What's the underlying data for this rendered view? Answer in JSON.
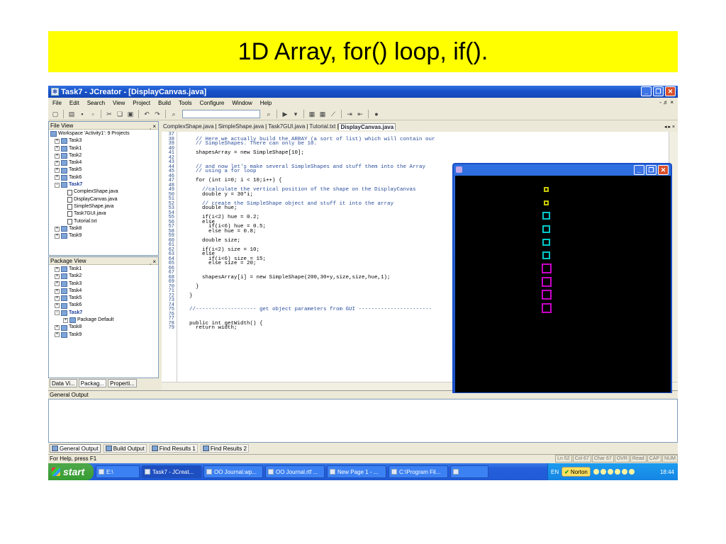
{
  "slide": {
    "title": "1D Array, for() loop, if()."
  },
  "window": {
    "title": "Task7 - JCreator - [DisplayCanvas.java]",
    "minimize": "_",
    "restore": "❐",
    "close": "✕",
    "mdi_controls": "- ♬ ×"
  },
  "menu": [
    "File",
    "Edit",
    "Search",
    "View",
    "Project",
    "Build",
    "Tools",
    "Configure",
    "Window",
    "Help"
  ],
  "file_view": {
    "title": "File View",
    "pin": "ฺ ×",
    "workspace": "Workspace 'Activity1': 9 Projects",
    "items": [
      {
        "label": "Task3",
        "depth": 0,
        "type": "project",
        "bold": false
      },
      {
        "label": "Task1",
        "depth": 0,
        "type": "project",
        "bold": false
      },
      {
        "label": "Task2",
        "depth": 0,
        "type": "project",
        "bold": false
      },
      {
        "label": "Task4",
        "depth": 0,
        "type": "project",
        "bold": false
      },
      {
        "label": "Task5",
        "depth": 0,
        "type": "project",
        "bold": false
      },
      {
        "label": "Task6",
        "depth": 0,
        "type": "project",
        "bold": false
      },
      {
        "label": "Task7",
        "depth": 0,
        "type": "project",
        "bold": true
      },
      {
        "label": "ComplexShape.java",
        "depth": 1,
        "type": "file",
        "bold": false
      },
      {
        "label": "DisplayCanvas.java",
        "depth": 1,
        "type": "file",
        "bold": false
      },
      {
        "label": "SimpleShape.java",
        "depth": 1,
        "type": "file",
        "bold": false
      },
      {
        "label": "Task7GUI.java",
        "depth": 1,
        "type": "file",
        "bold": false
      },
      {
        "label": "Tutorial.txt",
        "depth": 1,
        "type": "file",
        "bold": false
      },
      {
        "label": "Task8",
        "depth": 0,
        "type": "project",
        "bold": false
      },
      {
        "label": "Task9",
        "depth": 0,
        "type": "project",
        "bold": false
      }
    ]
  },
  "package_view": {
    "title": "Package View",
    "pin": "ฺ ×",
    "items": [
      {
        "label": "Task1",
        "depth": 0,
        "bold": false
      },
      {
        "label": "Task2",
        "depth": 0,
        "bold": false
      },
      {
        "label": "Task3",
        "depth": 0,
        "bold": false
      },
      {
        "label": "Task4",
        "depth": 0,
        "bold": false
      },
      {
        "label": "Task5",
        "depth": 0,
        "bold": false
      },
      {
        "label": "Task6",
        "depth": 0,
        "bold": false
      },
      {
        "label": "Task7",
        "depth": 0,
        "bold": true
      },
      {
        "label": "Package Default",
        "depth": 1,
        "bold": false
      },
      {
        "label": "Task8",
        "depth": 0,
        "bold": false
      },
      {
        "label": "Task9",
        "depth": 0,
        "bold": false
      }
    ]
  },
  "side_tabs": [
    "Data Vi...",
    "Packag...",
    "Properti..."
  ],
  "doc_tabs": [
    "ComplexShape.java",
    "SimpleShape.java",
    "Task7GUI.java",
    "Tutorial.txt",
    "DisplayCanvas.java"
  ],
  "doc_tab_arrows": "◂ ▸ ×",
  "line_numbers": [
    "37",
    "38",
    "39",
    "40",
    "41",
    "42",
    "43",
    "44",
    "45",
    "46",
    "47",
    "48",
    "49",
    "50",
    "51",
    "52",
    "53",
    "54",
    "55",
    "56",
    "57",
    "58",
    "59",
    "60",
    "61",
    "62",
    "63",
    "64",
    "65",
    "66",
    "67",
    "68",
    "69",
    "70",
    "71",
    "72",
    "73",
    "74",
    "75",
    "76",
    "77",
    "78",
    "79"
  ],
  "code_lines": [
    "",
    "    // Here we actually build the ARRAY (a sort of list) which will contain our",
    "    // SimpleShapes. There can only be 10.",
    "",
    "    shapesArray = new SimpleShape[10];",
    "",
    "",
    "    // and now let's make several SimpleShapes and stuff them into the Array",
    "    // using a for loop",
    "",
    "    for (int i=0; i < 10;i++) {",
    "",
    "      //calculate the vertical position of the shape on the DisplayCanvas",
    "      double y = 30*i;",
    "",
    "      // create the SimpleShape object and stuff it into the array",
    "      double hue;",
    "",
    "      if(i<2) hue = 0.2;",
    "      else",
    "        if(i<6) hue = 0.5;",
    "        else hue = 0.8;",
    "",
    "      double size;",
    "",
    "      if(i<2) size = 10;",
    "      else",
    "        if(i<6) size = 15;",
    "        else size = 20;",
    "",
    "",
    "      shapesArray[i] = new SimpleShape(200,30+y,size,size,hue,1);",
    "",
    "    }",
    "",
    "  }",
    "",
    "",
    "  //------------------- get object parameters from GUI -----------------------",
    "",
    "",
    "  public int getWidth() {",
    "    return width;"
  ],
  "output": {
    "title": "General Output"
  },
  "output_tabs": [
    "General Output",
    "Build Output",
    "Find Results 1",
    "Find Results 2"
  ],
  "status": {
    "text": "For Help, press F1",
    "cells": [
      "Ln 52",
      "Col 67",
      "Char 67",
      "OVR",
      "Read",
      "CAP",
      "NUM"
    ]
  },
  "taskbar": {
    "start": "start",
    "tasks": [
      "E:\\",
      "Task7 - JCreat...",
      "OO Journal.wp...",
      "OO Journal.rtf ...",
      "New Page 1 - ...",
      "C:\\Program Fil..."
    ],
    "lang": "EN",
    "norton": "Norton",
    "clock": "18:44"
  },
  "applet": {
    "shapes": [
      {
        "size": 10,
        "hue": 0.2,
        "color": "#c8c800"
      },
      {
        "size": 10,
        "hue": 0.2,
        "color": "#c8c800"
      },
      {
        "size": 15,
        "hue": 0.5,
        "color": "#00c8c8"
      },
      {
        "size": 15,
        "hue": 0.5,
        "color": "#00c8c8"
      },
      {
        "size": 15,
        "hue": 0.5,
        "color": "#00c8c8"
      },
      {
        "size": 15,
        "hue": 0.5,
        "color": "#00c8c8"
      },
      {
        "size": 20,
        "hue": 0.8,
        "color": "#c800c8"
      },
      {
        "size": 20,
        "hue": 0.8,
        "color": "#c800c8"
      },
      {
        "size": 20,
        "hue": 0.8,
        "color": "#c800c8"
      },
      {
        "size": 20,
        "hue": 0.8,
        "color": "#c800c8"
      }
    ]
  }
}
